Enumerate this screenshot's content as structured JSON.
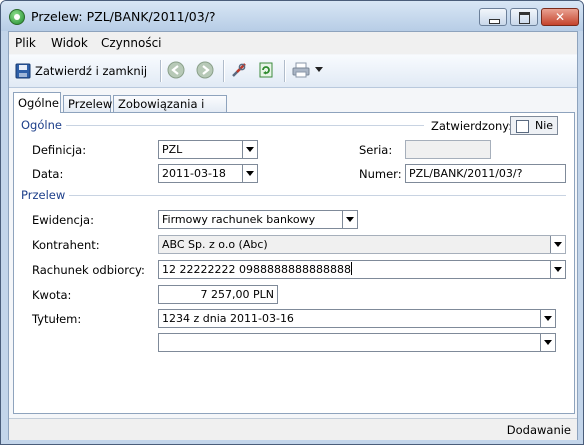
{
  "window": {
    "title": "Przelew: PZL/BANK/2011/03/?",
    "close_glyph": "✕",
    "icons": [
      "app-icon",
      "minimize-icon",
      "maximize-icon",
      "close-icon"
    ]
  },
  "menu": {
    "items": [
      {
        "label": "Plik"
      },
      {
        "label": "Widok"
      },
      {
        "label": "Czynności"
      }
    ]
  },
  "toolbar": {
    "save_label": "Zatwierdź i zamknij",
    "icons": [
      "save-icon",
      "back-icon",
      "forward-icon",
      "tools-icon",
      "refresh-icon",
      "print-icon",
      "dropdown-arrow-icon"
    ]
  },
  "tabs": [
    {
      "label": "Ogólne",
      "active": true
    },
    {
      "label": "Przelew",
      "active": false
    },
    {
      "label": "Zobowiązania i wpłaty",
      "active": false
    }
  ],
  "general": {
    "section_title": "Ogólne",
    "approved_label": "Zatwierdzony:",
    "approved_value": "Nie",
    "definition_label": "Definicja:",
    "definition_value": "PZL",
    "series_label": "Seria:",
    "series_value": "",
    "date_label": "Data:",
    "date_value": "2011-03-18",
    "number_label": "Numer:",
    "number_value": "PZL/BANK/2011/03/?"
  },
  "transfer": {
    "section_title": "Przelew",
    "register_label": "Ewidencja:",
    "register_value": "Firmowy rachunek bankowy",
    "contractor_label": "Kontrahent:",
    "contractor_value": "ABC Sp. z o.o (Abc)",
    "account_label": "Rachunek odbiorcy:",
    "account_value": "12 22222222 0988888888888888",
    "amount_label": "Kwota:",
    "amount_value": "7 257,00 PLN",
    "title_label": "Tytułem:",
    "title_value_1": "1234 z dnia 2011-03-16",
    "title_value_2": ""
  },
  "status": {
    "mode": "Dodawanie"
  },
  "colors": {
    "section_title": "#1d3f8a",
    "window_frame": "#c3d5ea",
    "close_button": "#c5432c"
  }
}
